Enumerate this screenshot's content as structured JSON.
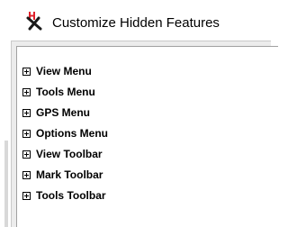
{
  "window": {
    "title": "Customize Hidden Features",
    "title_icon": "hidden-features-icon"
  },
  "tree": {
    "items": [
      {
        "label": "View Menu",
        "expander": "plus-expander-icon"
      },
      {
        "label": "Tools Menu",
        "expander": "plus-expander-icon"
      },
      {
        "label": "GPS Menu",
        "expander": "plus-expander-icon"
      },
      {
        "label": "Options Menu",
        "expander": "plus-expander-icon"
      },
      {
        "label": "View Toolbar",
        "expander": "plus-expander-icon"
      },
      {
        "label": "Mark Toolbar",
        "expander": "plus-expander-icon"
      },
      {
        "label": "Tools Toolbar",
        "expander": "plus-expander-icon"
      }
    ]
  },
  "colors": {
    "icon_red": "#e0202a",
    "icon_dark": "#1a1a1a",
    "panel_border": "#a0a0a0",
    "window_bg": "#ececec"
  }
}
